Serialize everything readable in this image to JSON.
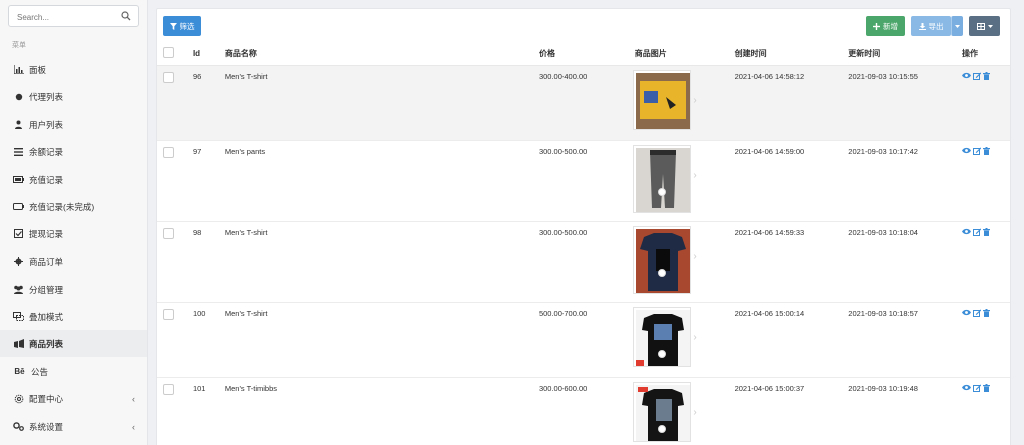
{
  "sidebar": {
    "search_placeholder": "Search...",
    "menu_title": "菜单",
    "items": [
      {
        "label": "面板",
        "icon": "chart-icon"
      },
      {
        "label": "代理列表",
        "icon": "circle-icon"
      },
      {
        "label": "用户列表",
        "icon": "user-icon"
      },
      {
        "label": "余额记录",
        "icon": "list-icon"
      },
      {
        "label": "充值记录",
        "icon": "battery-icon"
      },
      {
        "label": "充值记录(未完成)",
        "icon": "battery-empty-icon"
      },
      {
        "label": "提现记录",
        "icon": "checkbox-icon"
      },
      {
        "label": "商品订单",
        "icon": "gear-icon"
      },
      {
        "label": "分组管理",
        "icon": "users-icon"
      },
      {
        "label": "叠加模式",
        "icon": "clone-icon"
      },
      {
        "label": "商品列表",
        "icon": "shop-icon",
        "active": true
      },
      {
        "label": "公告",
        "icon": "behance-icon"
      },
      {
        "label": "配置中心",
        "icon": "settings-icon",
        "chevron": true
      },
      {
        "label": "系统设置",
        "icon": "cogs-icon",
        "chevron": true
      }
    ]
  },
  "toolbar": {
    "filter_label": "筛选",
    "add_label": "新增",
    "export_label": "导出"
  },
  "table": {
    "headers": {
      "id": "Id",
      "name": "商品名称",
      "price": "价格",
      "image": "商品图片",
      "created": "创建时间",
      "updated": "更新时间",
      "ops": "操作"
    },
    "rows": [
      {
        "id": "96",
        "name": "Men's T-shirt",
        "price": "300.00-400.00",
        "created": "2021-04-06 14:58:12",
        "updated": "2021-09-03 10:15:55"
      },
      {
        "id": "97",
        "name": "Men's pants",
        "price": "300.00-500.00",
        "created": "2021-04-06 14:59:00",
        "updated": "2021-09-03 10:17:42"
      },
      {
        "id": "98",
        "name": "Men's T-shirt",
        "price": "300.00-500.00",
        "created": "2021-04-06 14:59:33",
        "updated": "2021-09-03 10:18:04"
      },
      {
        "id": "100",
        "name": "Men's T-shirt",
        "price": "500.00-700.00",
        "created": "2021-04-06 15:00:14",
        "updated": "2021-09-03 10:18:57"
      },
      {
        "id": "101",
        "name": "Men's T-timibbs",
        "price": "300.00-600.00",
        "created": "2021-04-06 15:00:37",
        "updated": "2021-09-03 10:19:48"
      }
    ]
  },
  "colors": {
    "primary": "#3c8dd8",
    "success": "#4aa66a",
    "export": "#8ab9e6",
    "dark": "#5a6f84"
  }
}
